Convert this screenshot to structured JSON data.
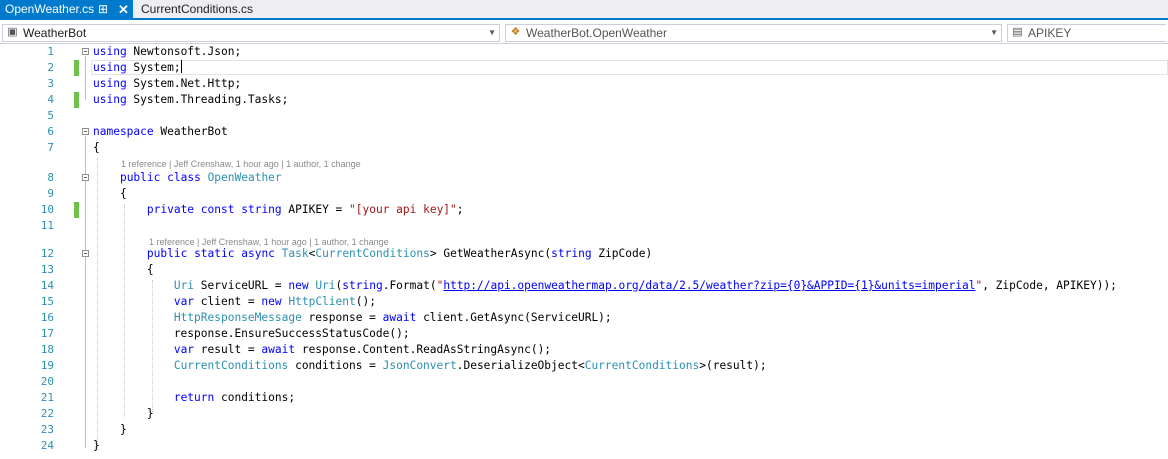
{
  "tabs": [
    {
      "label": "OpenWeather.cs",
      "active": true
    },
    {
      "label": "CurrentConditions.cs",
      "active": false
    }
  ],
  "navbar": {
    "project": "WeatherBot",
    "class": "WeatherBot.OpenWeather",
    "member": "APIKEY"
  },
  "codelens": {
    "class": "1 reference | Jeff Crenshaw, 1 hour ago | 1 author, 1 change",
    "method": "1 reference | Jeff Crenshaw, 1 hour ago | 1 author, 1 change"
  },
  "line_numbers": [
    "1",
    "2",
    "3",
    "4",
    "5",
    "6",
    "7",
    "8",
    "9",
    "10",
    "11",
    "12",
    "13",
    "14",
    "15",
    "16",
    "17",
    "18",
    "19",
    "20",
    "21",
    "22",
    "23",
    "24"
  ],
  "code": {
    "l1": [
      {
        "t": "using",
        "c": "kw"
      },
      {
        "t": " Newtonsoft.Json;"
      }
    ],
    "l2": [
      {
        "t": "using",
        "c": "kw"
      },
      {
        "t": " System;"
      }
    ],
    "l3": [
      {
        "t": "using",
        "c": "kw"
      },
      {
        "t": " System.Net.Http;"
      }
    ],
    "l4": [
      {
        "t": "using",
        "c": "kw"
      },
      {
        "t": " System.Threading.Tasks;"
      }
    ],
    "l5": [],
    "l6": [
      {
        "t": "namespace",
        "c": "kw"
      },
      {
        "t": " WeatherBot"
      }
    ],
    "l7": [
      {
        "t": "{"
      }
    ],
    "l8": [
      {
        "t": "    "
      },
      {
        "t": "public",
        "c": "kw"
      },
      {
        "t": " "
      },
      {
        "t": "class",
        "c": "kw"
      },
      {
        "t": " "
      },
      {
        "t": "OpenWeather",
        "c": "ty"
      }
    ],
    "l9": [
      {
        "t": "    {"
      }
    ],
    "l10": [
      {
        "t": "        "
      },
      {
        "t": "private",
        "c": "kw"
      },
      {
        "t": " "
      },
      {
        "t": "const",
        "c": "kw"
      },
      {
        "t": " "
      },
      {
        "t": "string",
        "c": "kw"
      },
      {
        "t": " APIKEY = "
      },
      {
        "t": "\"[your api key]\"",
        "c": "st"
      },
      {
        "t": ";"
      }
    ],
    "l11": [],
    "l12": [
      {
        "t": "        "
      },
      {
        "t": "public",
        "c": "kw"
      },
      {
        "t": " "
      },
      {
        "t": "static",
        "c": "kw"
      },
      {
        "t": " "
      },
      {
        "t": "async",
        "c": "kw"
      },
      {
        "t": " "
      },
      {
        "t": "Task",
        "c": "ty"
      },
      {
        "t": "<"
      },
      {
        "t": "CurrentConditions",
        "c": "ty"
      },
      {
        "t": "> GetWeatherAsync("
      },
      {
        "t": "string",
        "c": "kw"
      },
      {
        "t": " ZipCode)"
      }
    ],
    "l13": [
      {
        "t": "        {"
      }
    ],
    "l14": [
      {
        "t": "            "
      },
      {
        "t": "Uri",
        "c": "ty"
      },
      {
        "t": " ServiceURL = "
      },
      {
        "t": "new",
        "c": "kw"
      },
      {
        "t": " "
      },
      {
        "t": "Uri",
        "c": "ty"
      },
      {
        "t": "("
      },
      {
        "t": "string",
        "c": "kw"
      },
      {
        "t": ".Format("
      },
      {
        "t": "\"",
        "c": "st"
      },
      {
        "t": "http://api.openweathermap.org/data/2.5/weather?zip={0}&APPID={1}&units=imperial",
        "c": "url"
      },
      {
        "t": "\"",
        "c": "st"
      },
      {
        "t": ", ZipCode, APIKEY));"
      }
    ],
    "l15": [
      {
        "t": "            "
      },
      {
        "t": "var",
        "c": "kw"
      },
      {
        "t": " client = "
      },
      {
        "t": "new",
        "c": "kw"
      },
      {
        "t": " "
      },
      {
        "t": "HttpClient",
        "c": "ty"
      },
      {
        "t": "();"
      }
    ],
    "l16": [
      {
        "t": "            "
      },
      {
        "t": "HttpResponseMessage",
        "c": "ty"
      },
      {
        "t": " response = "
      },
      {
        "t": "await",
        "c": "kw"
      },
      {
        "t": " client.GetAsync(ServiceURL);"
      }
    ],
    "l17": [
      {
        "t": "            response.EnsureSuccessStatusCode();"
      }
    ],
    "l18": [
      {
        "t": "            "
      },
      {
        "t": "var",
        "c": "kw"
      },
      {
        "t": " result = "
      },
      {
        "t": "await",
        "c": "kw"
      },
      {
        "t": " response.Content.ReadAsStringAsync();"
      }
    ],
    "l19": [
      {
        "t": "            "
      },
      {
        "t": "CurrentConditions",
        "c": "ty"
      },
      {
        "t": " conditions = "
      },
      {
        "t": "JsonConvert",
        "c": "ty"
      },
      {
        "t": ".DeserializeObject<"
      },
      {
        "t": "CurrentConditions",
        "c": "ty"
      },
      {
        "t": ">(result);"
      }
    ],
    "l20": [],
    "l21": [
      {
        "t": "            "
      },
      {
        "t": "return",
        "c": "kw"
      },
      {
        "t": " conditions;"
      }
    ],
    "l22": [
      {
        "t": "        }"
      }
    ],
    "l23": [
      {
        "t": "    }"
      }
    ],
    "l24": [
      {
        "t": "}"
      }
    ]
  },
  "colors": {
    "accent": "#007acc",
    "keyword": "#0000ff",
    "type": "#2b91af",
    "string": "#a31515",
    "line_number": "#2b91af",
    "change_marker": "#6cc24a"
  },
  "icons": {
    "pin": "pin-icon",
    "close": "close-icon",
    "project": "csharp-project-icon",
    "class": "class-icon",
    "member": "field-icon",
    "dropdown": "chevron-down-icon"
  }
}
